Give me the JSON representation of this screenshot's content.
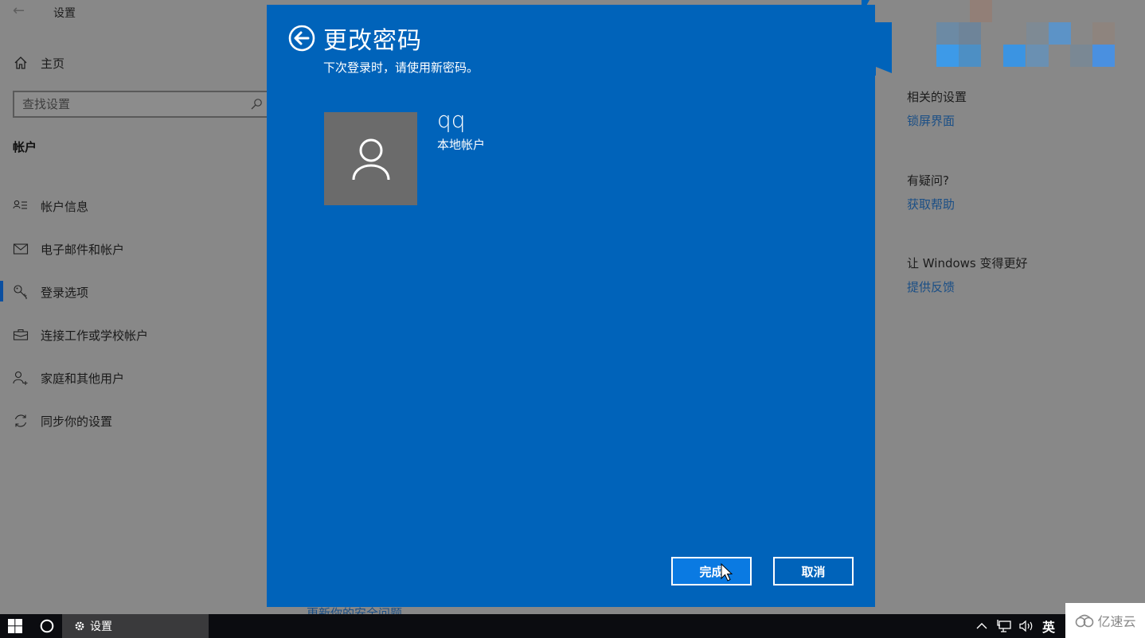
{
  "window": {
    "app_title": "设置",
    "back_icon": "arrow-left-icon"
  },
  "sidebar": {
    "home_label": "主页",
    "home_icon": "home-icon",
    "search_placeholder": "查找设置",
    "search_icon": "search-icon",
    "section_header": "帐户",
    "items": [
      {
        "label": "帐户信息",
        "icon": "account-info-icon",
        "active": false
      },
      {
        "label": "电子邮件和帐户",
        "icon": "mail-icon",
        "active": false
      },
      {
        "label": "登录选项",
        "icon": "key-icon",
        "active": true
      },
      {
        "label": "连接工作或学校帐户",
        "icon": "briefcase-icon",
        "active": false
      },
      {
        "label": "家庭和其他用户",
        "icon": "add-person-icon",
        "active": false
      },
      {
        "label": "同步你的设置",
        "icon": "sync-icon",
        "active": false
      }
    ]
  },
  "right_panel": {
    "sections": [
      {
        "title": "相关的设置",
        "link": "锁屏界面"
      },
      {
        "title": "有疑问?",
        "link": "获取帮助"
      },
      {
        "title": "让 Windows 变得更好",
        "link": "提供反馈"
      }
    ]
  },
  "background_content": {
    "partial_link": "更新你的安全问题"
  },
  "dialog": {
    "title": "更改密码",
    "subtitle": "下次登录时，请使用新密码。",
    "back_icon": "circle-arrow-left-icon",
    "user": {
      "name": "qq",
      "account_type": "本地帐户",
      "avatar_icon": "person-icon"
    },
    "buttons": {
      "finish": "完成",
      "cancel": "取消"
    },
    "colors": {
      "background": "#0063ba",
      "primary_button": "#0a7ae2"
    }
  },
  "taskbar": {
    "start_icon": "windows-logo-icon",
    "search_icon": "cortana-circle-icon",
    "active_app": {
      "label": "设置",
      "icon": "gear-icon"
    },
    "tray": {
      "chevron_icon": "chevron-up-icon",
      "network_icon": "network-icon",
      "volume_icon": "volume-icon",
      "ime_label": "英"
    }
  },
  "watermark": {
    "text": "亿速云",
    "icon": "cloud-logo-icon"
  }
}
